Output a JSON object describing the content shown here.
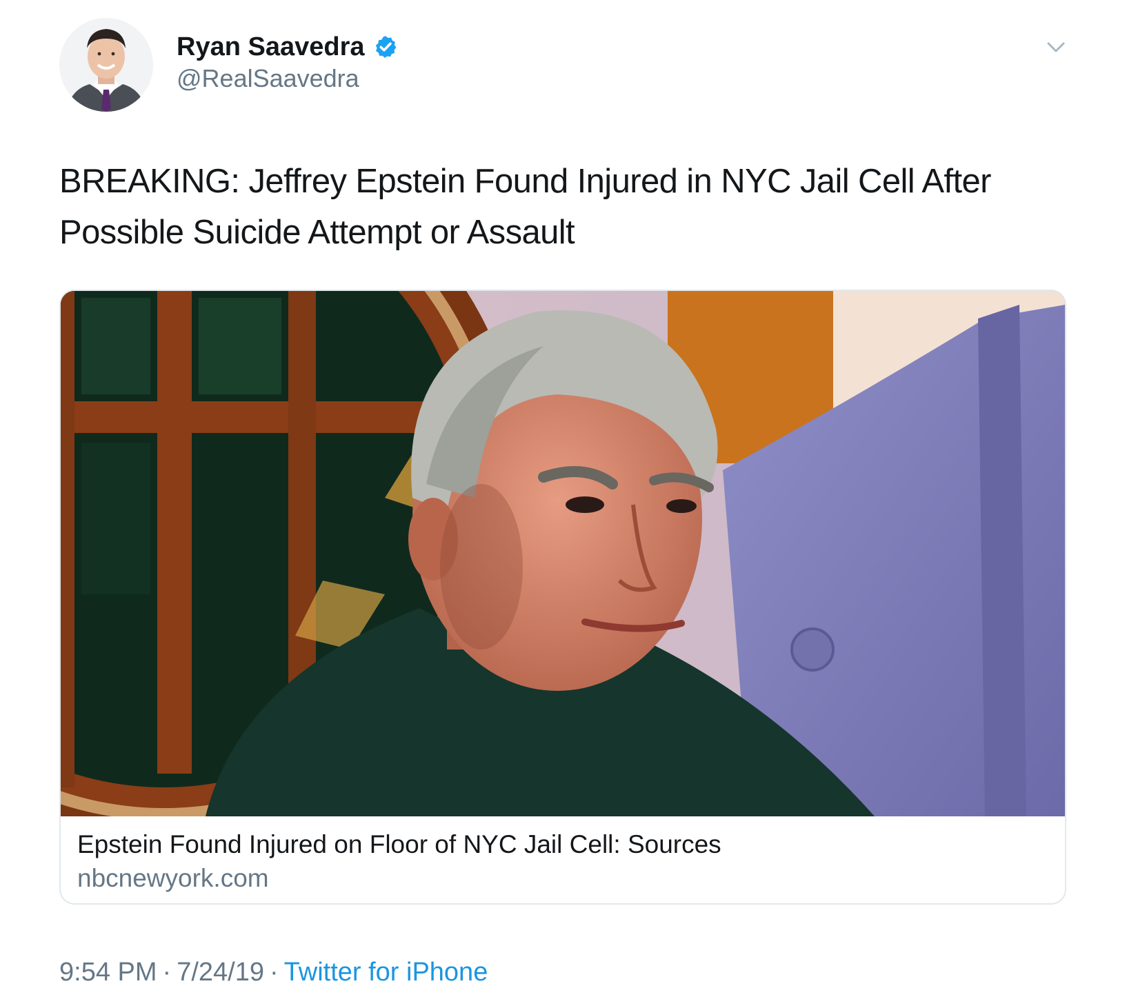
{
  "tweet": {
    "author": {
      "display_name": "Ryan Saavedra",
      "handle": "@RealSaavedra",
      "verified_icon": "verified-badge-icon"
    },
    "menu_icon": "chevron-down-icon",
    "text": "BREAKING: Jeffrey Epstein Found Injured in NYC Jail Cell After Possible Suicide Attempt or Assault",
    "card": {
      "title": "Epstein Found Injured on Floor of NYC Jail Cell: Sources",
      "domain": "nbcnewyork.com"
    },
    "meta": {
      "time": "9:54 PM",
      "separator": "·",
      "date": "7/24/19",
      "source": "Twitter for iPhone"
    }
  },
  "colors": {
    "text_primary": "#14171a",
    "text_secondary": "#657786",
    "accent_blue": "#1b95e0",
    "verified_blue": "#1da1f2",
    "border": "#e1e8ed"
  }
}
